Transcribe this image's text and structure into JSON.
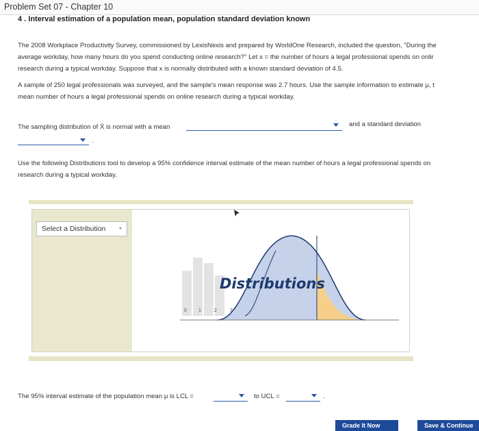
{
  "header": {
    "title": "Problem Set 07 - Chapter 10"
  },
  "question": {
    "title": "4 . Interval estimation of a population mean, population standard deviation known",
    "paragraph1": [
      "The 2008 Workplace Productivity Survey, commissioned by LexisNexis and prepared by WorldOne Research, included the question, \"During the",
      "average workday, how many hours do you spend conducting online research?\" Let x = the number of hours a legal professional spends on onlir",
      "research during a typical workday. Suppose that x is normally distributed with a known standard deviation of 4.5."
    ],
    "paragraph2": [
      "A sample of 250 legal professionals was surveyed, and the sample's mean response was 2.7 hours. Use the sample information to estimate μ, t",
      "mean number of hours a legal professional spends on online research during a typical workday."
    ],
    "sampling_prefix": "The sampling distribution of X̄ is normal with a mean",
    "sampling_suffix": "and a standard deviation",
    "paragraph3": [
      "Use the following Distributions tool to develop a 95% confidence interval estimate of the mean number of hours a legal professional spends on",
      "research during a typical workday."
    ],
    "interval_prefix": "The 95% interval estimate of the population mean μ is LCL =",
    "interval_mid": "to UCL ="
  },
  "tool": {
    "select_label": "Select a Distribution",
    "graphic_title": "Distributions",
    "tick_labels": [
      "0",
      "1",
      "2",
      "3"
    ]
  },
  "buttons": {
    "grade": "Grade It Now",
    "save": "Save & Continue"
  },
  "colors": {
    "accent": "#2b57a6",
    "tool_band": "#e7e3c4",
    "curve_fill": "#c5d2ea",
    "tail_fill": "#f6d08a"
  }
}
